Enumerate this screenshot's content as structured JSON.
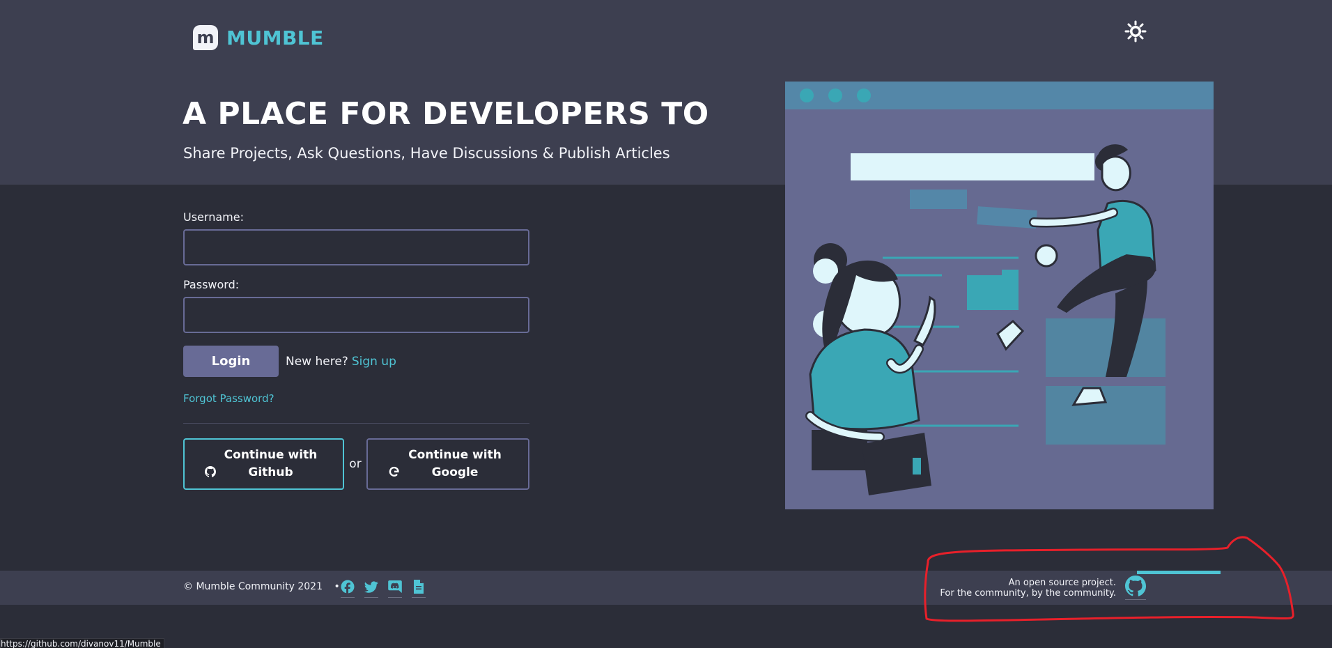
{
  "brand": {
    "logo_letter": "m",
    "name": "MUMBLE"
  },
  "header": {
    "theme_toggle_icon": "sun-icon"
  },
  "hero": {
    "title": "A PLACE FOR DEVELOPERS TO",
    "subtitle": "Share Projects, Ask Questions, Have Discussions & Publish Articles"
  },
  "login_form": {
    "username_label": "Username:",
    "username_value": "",
    "password_label": "Password:",
    "password_value": "",
    "login_button": "Login",
    "new_here_text": "New here?",
    "signup_link": "Sign up",
    "forgot_link": "Forgot Password?"
  },
  "social_login": {
    "github_button": "Continue with Github",
    "separator": "or",
    "google_button": "Continue with Google"
  },
  "footer": {
    "copyright": "© Mumble Community 2021",
    "bullet": "•",
    "social_icons": [
      "facebook-icon",
      "twitter-icon",
      "discord-icon",
      "document-icon"
    ],
    "oss_line1": "An open source project.",
    "oss_line2": "For the community, by the community."
  },
  "status_bar": {
    "url": "https://github.com/divanov11/Mumble"
  },
  "colors": {
    "accent": "#4fc4d4",
    "button": "#686b96",
    "band": "#3d3f50",
    "background": "#2b2d38",
    "annotation": "#e8202a"
  }
}
